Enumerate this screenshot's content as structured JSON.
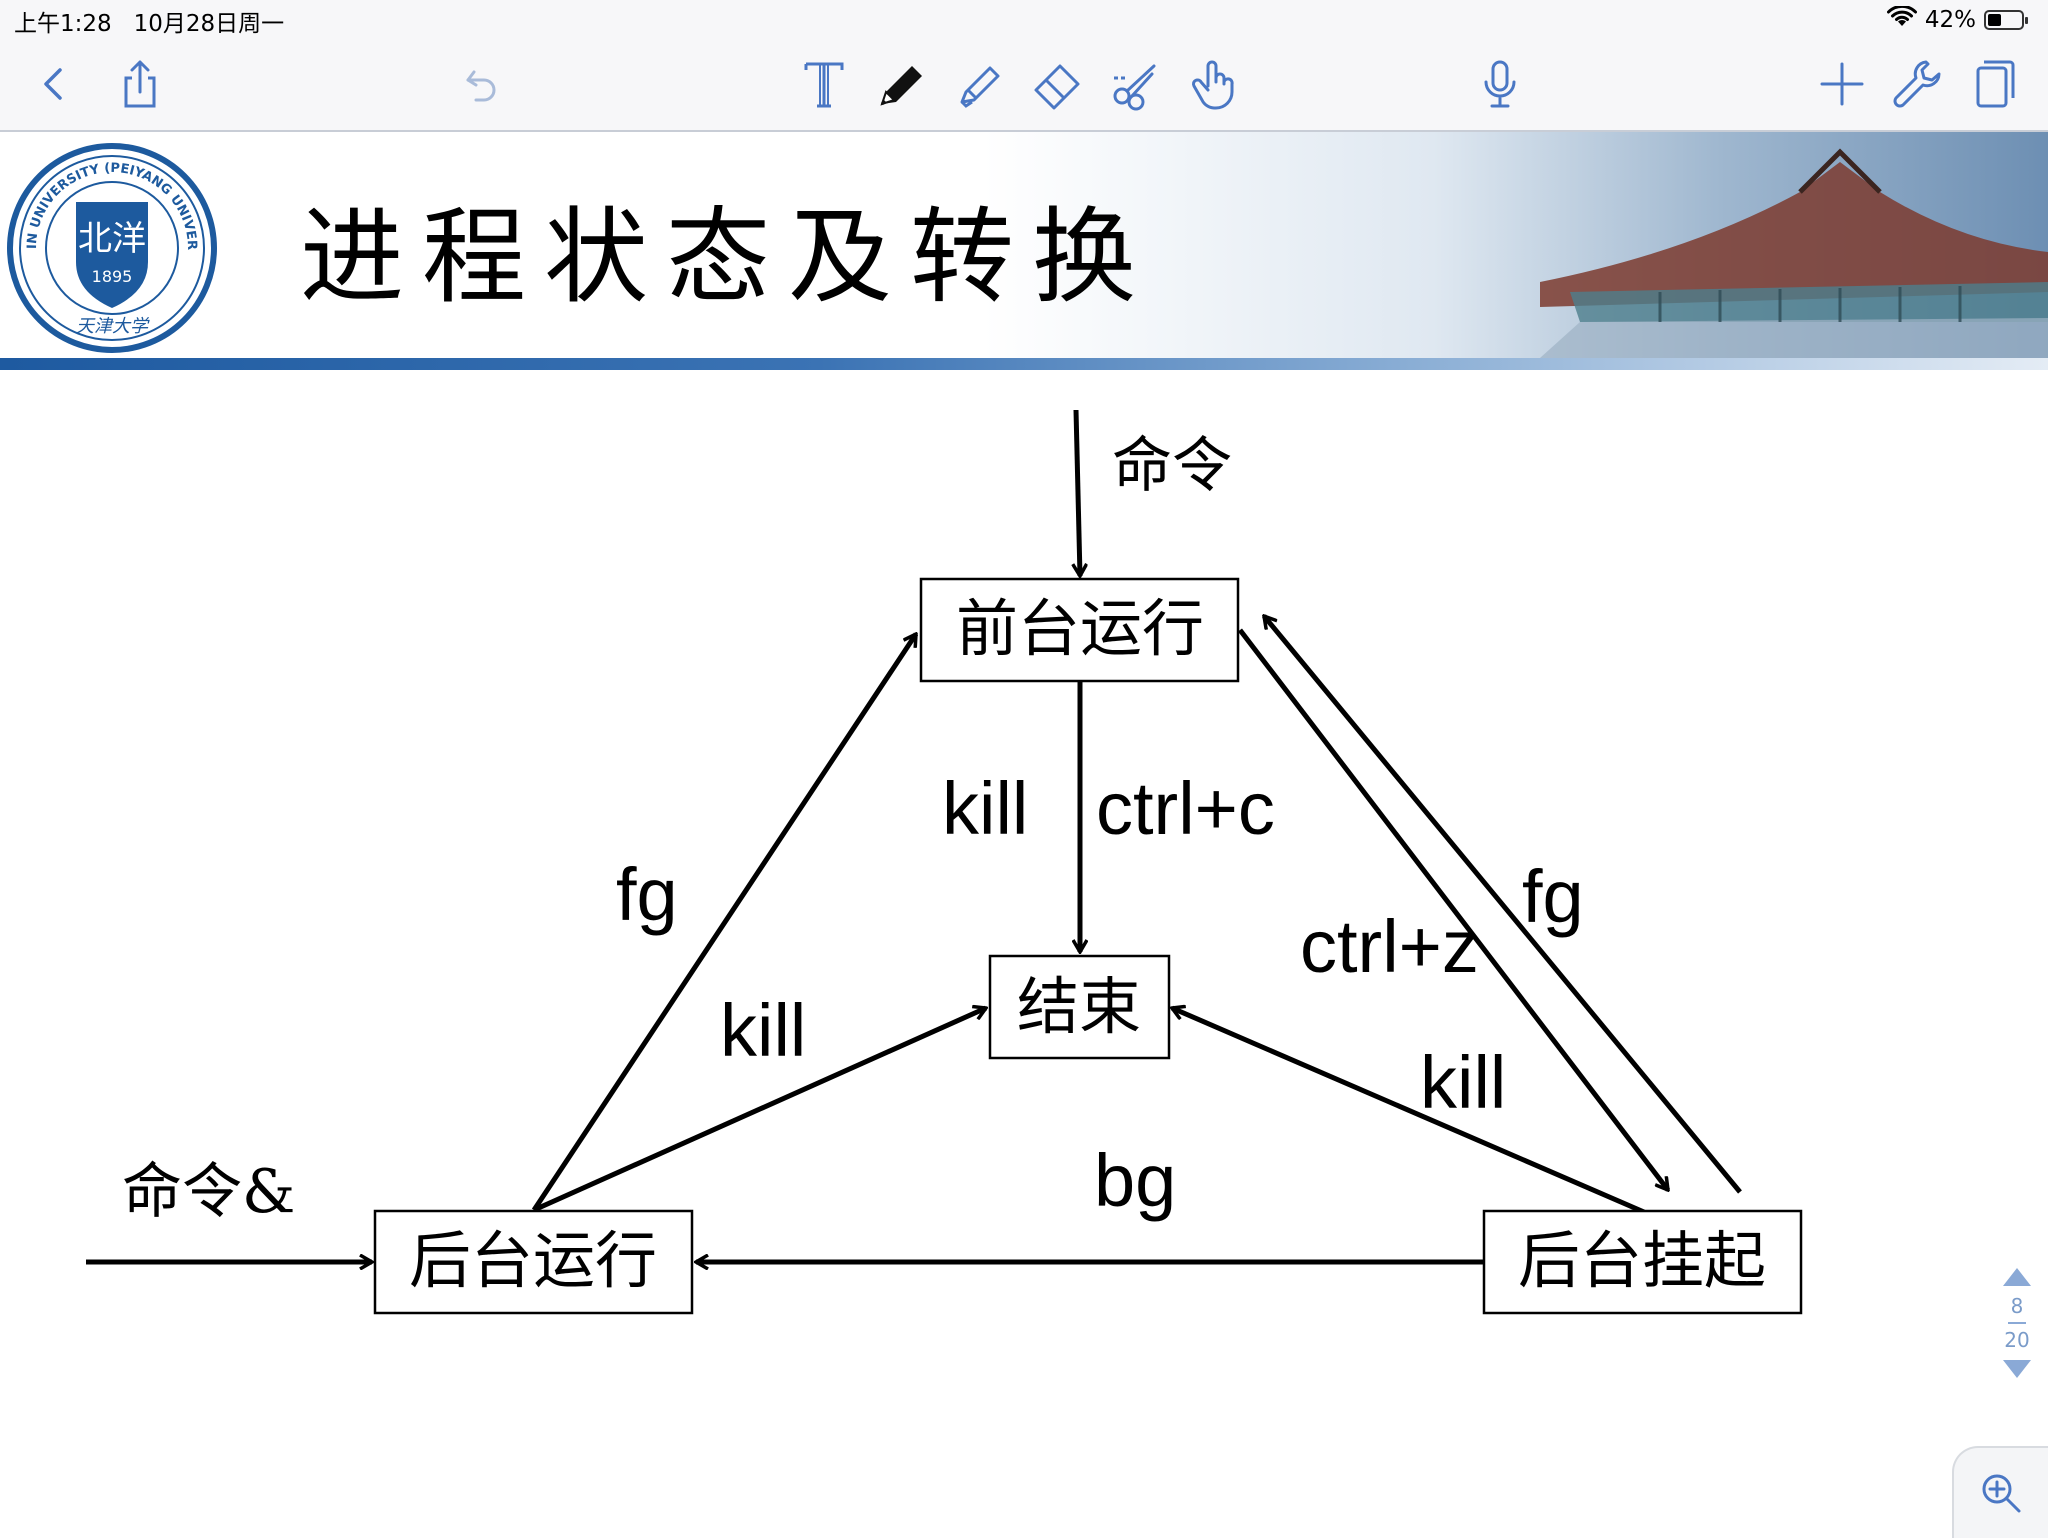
{
  "status_bar": {
    "time": "上午1:28",
    "date": "10月28日周一",
    "battery": "42%",
    "battery_level": 0.42
  },
  "toolbar": {
    "left": [
      "back-icon",
      "share-icon",
      "undo-icon"
    ],
    "center": [
      "text-tool-icon",
      "pen-icon",
      "highlighter-icon",
      "eraser-icon",
      "lasso-scissors-icon",
      "hand-pointer-icon"
    ],
    "mic": "microphone-icon",
    "right": [
      "add-icon",
      "settings-wrench-icon",
      "pages-icon"
    ],
    "accent_color": "#5b7fc0"
  },
  "slide": {
    "title": "进程状态及转换",
    "logo_text": "TIANJIN UNIVERSITY (PEIYANG UNIVERSITY)",
    "logo_year": "1895",
    "logo_seal": "北洋",
    "logo_script": "天津大学"
  },
  "diagram": {
    "nodes": {
      "foreground": "前台运行",
      "end": "结束",
      "background": "后台运行",
      "suspended": "后台挂起"
    },
    "inputs": {
      "command": "命令",
      "command_bg": "命令&"
    },
    "edges": {
      "kill_fg": "kill",
      "ctrl_c": "ctrl+c",
      "fg_left": "fg",
      "kill_bg": "kill",
      "ctrl_z": "ctrl+z",
      "fg_right": "fg",
      "kill_susp": "kill",
      "bg": "bg"
    }
  },
  "pager": {
    "current": "8",
    "total": "20"
  }
}
